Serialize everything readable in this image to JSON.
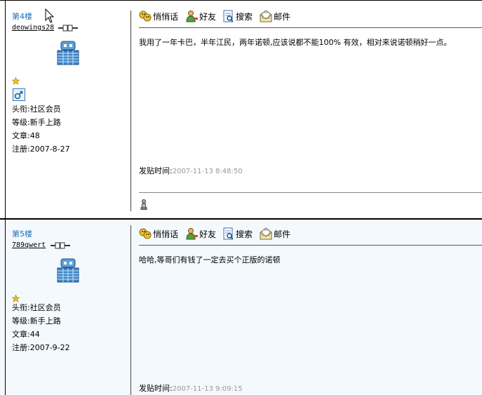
{
  "toolbar": {
    "whisper": "悄悄话",
    "friend": "好友",
    "search": "搜索",
    "mail": "邮件"
  },
  "posts": [
    {
      "floor": "第4楼",
      "username": "deowings28",
      "title": "头衔:社区会员",
      "level": "等级:新手上路",
      "articles": "文章:48",
      "registered": "注册:2007-8-27",
      "content": "我用了一年卡巴，半年江民，两年诺顿,应该说都不能100% 有效，相对来说诺顿稍好一点。",
      "time_label": "发贴时间:",
      "time": "2007-11-13 8:48:50"
    },
    {
      "floor": "第5楼",
      "username": "789qwert",
      "title": "头衔:社区会员",
      "level": "等级:新手上路",
      "articles": "文章:44",
      "registered": "注册:2007-9-22",
      "content": "哈哈,等哥们有钱了一定去买个正版的诺顿",
      "time_label": "发贴时间:",
      "time": "2007-11-13 9:09:15"
    }
  ]
}
